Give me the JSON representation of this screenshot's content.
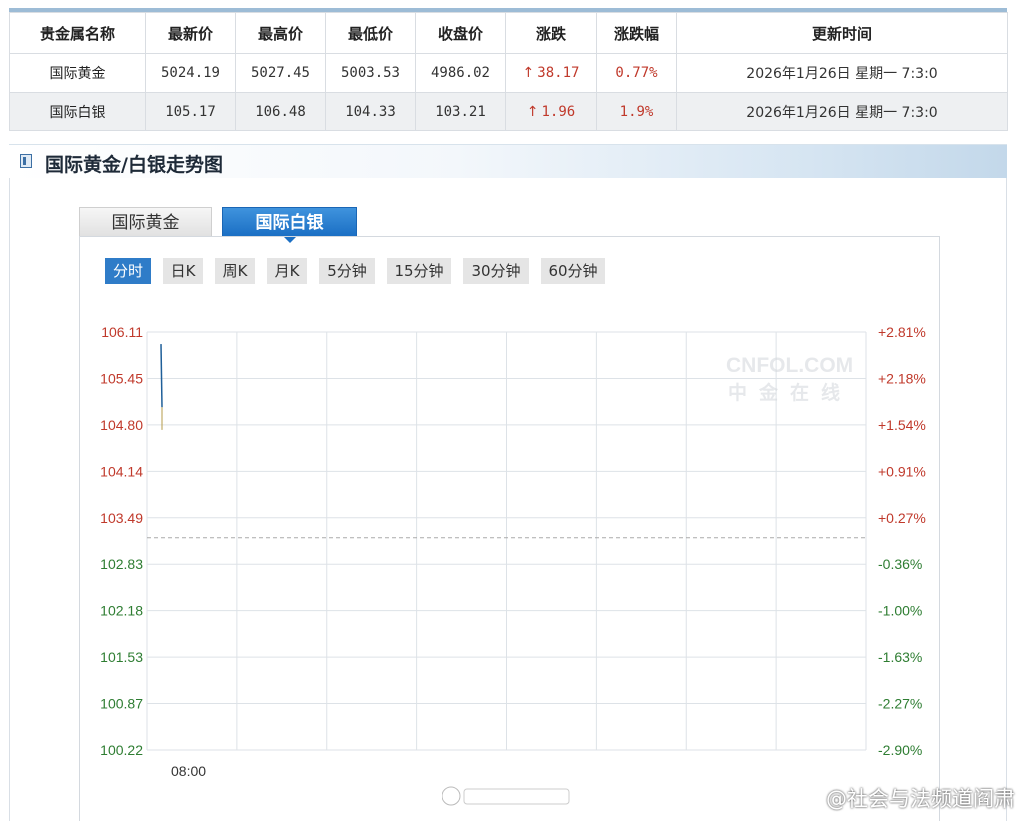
{
  "table": {
    "headers": [
      "贵金属名称",
      "最新价",
      "最高价",
      "最低价",
      "收盘价",
      "涨跌",
      "涨跌幅",
      "更新时间"
    ],
    "rows": [
      {
        "name": "国际黄金",
        "latest": "5024.19",
        "high": "5027.45",
        "low": "5003.53",
        "close": "4986.02",
        "change_arrow": "↑",
        "change": "38.17",
        "change_pct": "0.77%",
        "time": "2026年1月26日  星期一  7:3:0"
      },
      {
        "name": "国际白银",
        "latest": "105.17",
        "high": "106.48",
        "low": "104.33",
        "close": "103.21",
        "change_arrow": "↑",
        "change": "1.96",
        "change_pct": "1.9%",
        "time": "2026年1月26日  星期一  7:3:0"
      }
    ]
  },
  "section": {
    "title": "国际黄金/白银走势图"
  },
  "tabs": [
    {
      "label": "国际黄金",
      "active": false
    },
    {
      "label": "国际白银",
      "active": true
    }
  ],
  "periods": [
    {
      "label": "分时",
      "active": true
    },
    {
      "label": "日K"
    },
    {
      "label": "周K"
    },
    {
      "label": "月K"
    },
    {
      "label": "5分钟"
    },
    {
      "label": "15分钟"
    },
    {
      "label": "30分钟"
    },
    {
      "label": "60分钟"
    }
  ],
  "colors": {
    "up": "#c0392b",
    "down": "#2e7d32",
    "accent": "#2f7cc8",
    "line": "#1f5f99"
  },
  "watermark": {
    "text": "@社会与法频道阎肃",
    "chart_logo_en": "CNFOL.COM",
    "chart_logo_cn": "中金在线"
  },
  "chart_data": {
    "type": "line",
    "y_ticks_left": [
      "106.11",
      "105.45",
      "104.80",
      "104.14",
      "103.49",
      "102.83",
      "102.18",
      "101.53",
      "100.87",
      "100.22"
    ],
    "y_ticks_right": [
      "+2.81%",
      "+2.18%",
      "+1.54%",
      "+0.91%",
      "+0.27%",
      "-0.36%",
      "-1.00%",
      "-1.63%",
      "-2.27%",
      "-2.90%"
    ],
    "ylim": [
      100.22,
      106.11
    ],
    "x_tick": "08:00",
    "reference_close": 103.21,
    "series": [
      {
        "x": [
          0,
          1
        ],
        "values": [
          105.94,
          105.05
        ]
      }
    ]
  }
}
